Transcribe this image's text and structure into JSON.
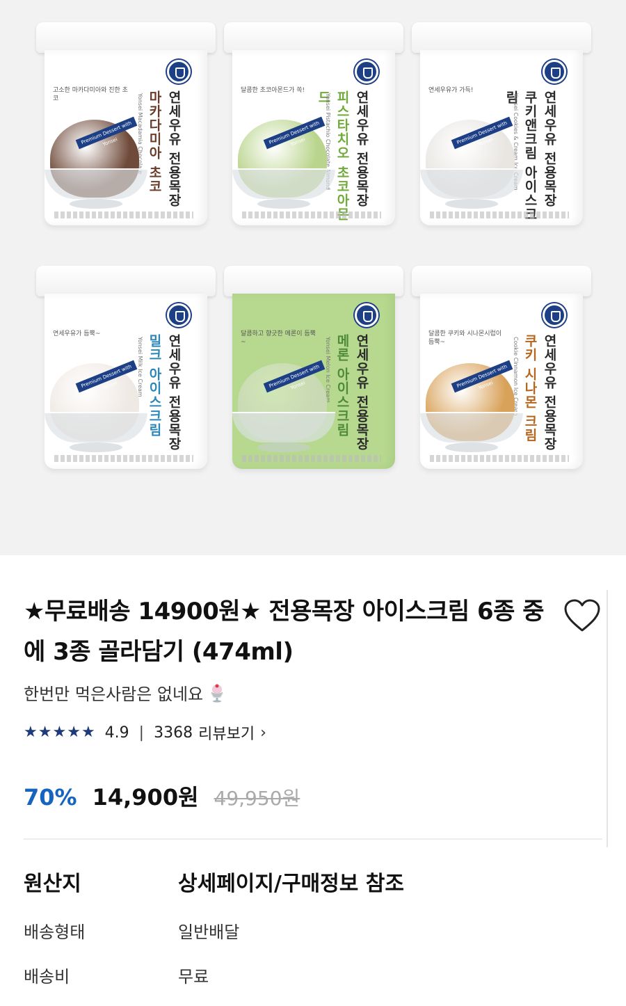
{
  "product": {
    "title": "★무료배송 14900원★ 전용목장 아이스크림 6종 중에 3종 골라담기 (474ml)",
    "subtitle": "한번만 먹은사람은 없네요",
    "subtitle_icon": "sundae-icon",
    "wishlist_icon": "heart-outline-icon",
    "rating": {
      "stars": 5,
      "score": "4.9",
      "separator": "|",
      "review_count": "3368",
      "review_label": "리뷰보기",
      "star_color": "#1e3a7a"
    },
    "pricing": {
      "discount": "70%",
      "price": "14,900원",
      "original_price": "49,950원",
      "discount_color": "#1565c0"
    }
  },
  "specs": [
    {
      "key": "원산지",
      "value": "상세페이지/구매정보 참조"
    },
    {
      "key": "배송형태",
      "value": "일반배달"
    },
    {
      "key": "배송비",
      "value": "무료"
    }
  ],
  "tubs": [
    {
      "brand": "연세우유 전용목장",
      "flavor": "마카다미아 초코",
      "english": "Yonsei Macadamia Chocolate",
      "tagline": "고소한 마카다미아와 진한 초코",
      "ribbon": "Premium Dessert with Yonsei",
      "flavor_color": "#6b3b2a",
      "scoop_color": "#6f4a3a",
      "body_color": "#ffffff"
    },
    {
      "brand": "연세우유 전용목장",
      "flavor": "피스타치오 초코아몬드",
      "english": "Yonsei Pistachio Chocolate Almond",
      "tagline": "달콤한 초코아몬드가 쏙!",
      "ribbon": "Premium Dessert with Yonsei",
      "flavor_color": "#6faa3a",
      "scoop_color": "#b9d48c",
      "body_color": "#ffffff"
    },
    {
      "brand": "연세우유 전용목장",
      "flavor": "쿠키앤크림 아이스크림",
      "english": "Yonsei Cookies & Cream Ice Cream",
      "tagline": "연세우유가 가득!",
      "ribbon": "Premium Dessert with Yonsei",
      "flavor_color": "#2b2b2b",
      "scoop_color": "#e9e6e2",
      "body_color": "#ffffff"
    },
    {
      "brand": "연세우유 전용목장",
      "flavor": "밀크 아이스크림",
      "english": "Yonsei Milk Ice Cream",
      "tagline": "연세우유가 듬뿍~",
      "ribbon": "Premium Dessert with Yonsei",
      "flavor_color": "#2a86b8",
      "scoop_color": "#efe9e4",
      "body_color": "#ffffff"
    },
    {
      "brand": "연세우유 전용목장",
      "flavor": "메론 아이스크림",
      "english": "Yonsei Melon Ice Cream",
      "tagline": "달콤하고 향긋한 메론이 듬뿍~",
      "ribbon": "Premium Dessert with Yonsei",
      "flavor_color": "#4d8a3a",
      "scoop_color": "#c9d9b4",
      "body_color": "#b7d98f"
    },
    {
      "brand": "연세우유 전용목장",
      "flavor": "쿠키 시나몬 크림",
      "english": "Cookie Cinnamon Ice Cream",
      "tagline": "달콤한 쿠키와 시나몬시럽이 듬뿍~",
      "ribbon": "Premium Dessert with Yonsei",
      "flavor_color": "#b5651d",
      "scoop_color": "#d9a25a",
      "body_color": "#ffffff"
    }
  ]
}
